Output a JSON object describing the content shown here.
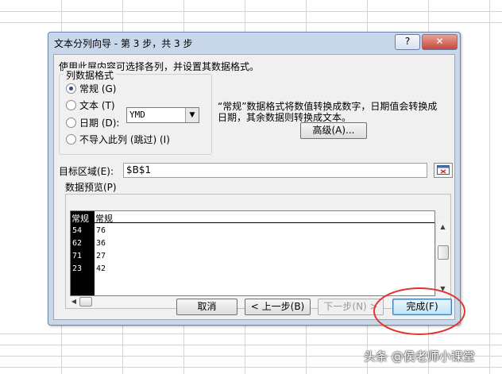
{
  "dialog": {
    "title": "文本分列向导 - 第 3 步，共 3 步",
    "help_label": "?",
    "close_label": "✕",
    "instruction": "使用此屏内容可选择各列，并设置其数据格式。",
    "column_format": {
      "legend": "列数据格式",
      "options": [
        {
          "label": "常规 (G)",
          "checked": true
        },
        {
          "label": "文本 (T)",
          "checked": false
        },
        {
          "label": "日期 (D):",
          "checked": false
        },
        {
          "label": "不导入此列 (跳过) (I)",
          "checked": false
        }
      ],
      "date_format": "YMD"
    },
    "description_line1": "“常规”数据格式将数值转换成数字，日期值会转换成",
    "description_line2": "日期，其余数据则转换成文本。",
    "advanced_label": "高级(A)...",
    "destination_label": "目标区域(E):",
    "destination_value": "$B$1",
    "preview_label": "数据预览(P)",
    "preview": {
      "headers": [
        "常规",
        "常规"
      ],
      "rows": [
        [
          "54",
          "76"
        ],
        [
          "62",
          "36"
        ],
        [
          "71",
          "27"
        ],
        [
          "23",
          "42"
        ]
      ]
    },
    "buttons": {
      "cancel": "取消",
      "prev": "< 上一步(B)",
      "next": "下一步(N) >",
      "finish": "完成(F)"
    }
  },
  "watermark": "头条 @侯老师小课堂"
}
